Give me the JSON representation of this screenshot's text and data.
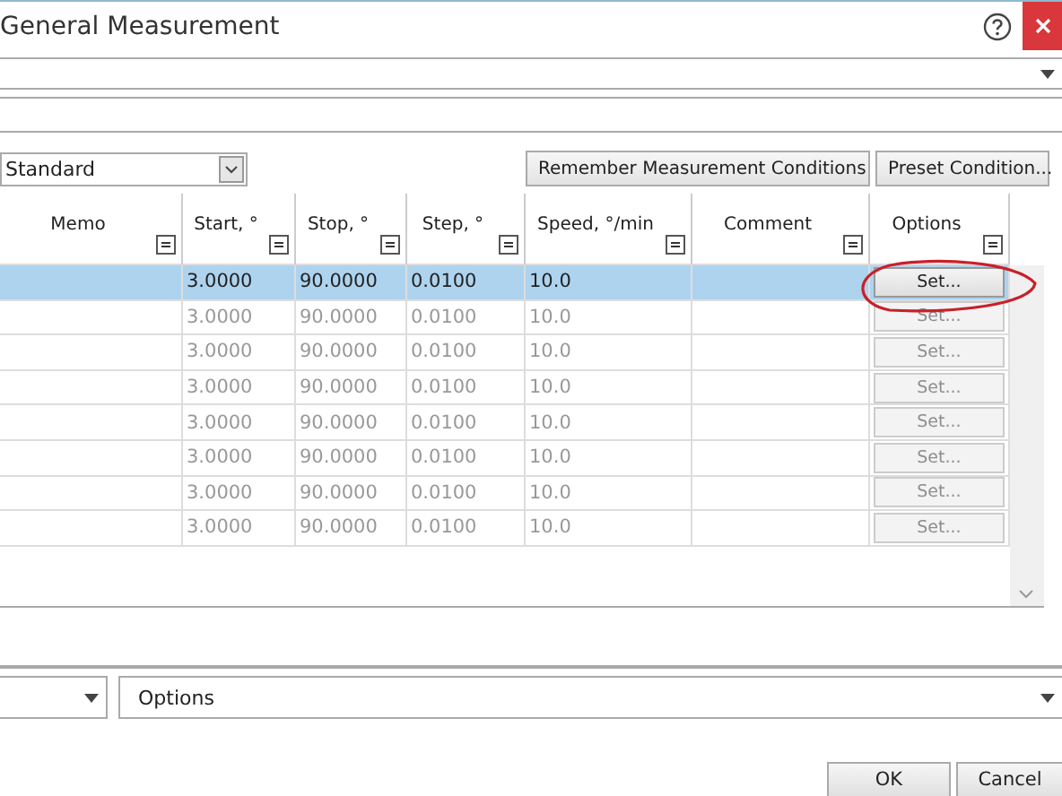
{
  "window": {
    "title": "General Measurement"
  },
  "condition_select": {
    "value": "Standard"
  },
  "toolbar_buttons": [
    "Remember Measurement Conditions",
    "Preset Condition..."
  ],
  "table": {
    "columns": [
      "Memo",
      "Start, °",
      "Stop, °",
      "Step, °",
      "Speed, °/min",
      "Comment",
      "Options"
    ],
    "rows": [
      {
        "selected": true,
        "disabled": false,
        "start": "3.0000",
        "stop": "90.0000",
        "step": "0.0100",
        "speed": "10.0",
        "option": "Set..."
      },
      {
        "selected": false,
        "disabled": true,
        "start": "3.0000",
        "stop": "90.0000",
        "step": "0.0100",
        "speed": "10.0",
        "option": "Set..."
      },
      {
        "selected": false,
        "disabled": true,
        "start": "3.0000",
        "stop": "90.0000",
        "step": "0.0100",
        "speed": "10.0",
        "option": "Set..."
      },
      {
        "selected": false,
        "disabled": true,
        "start": "3.0000",
        "stop": "90.0000",
        "step": "0.0100",
        "speed": "10.0",
        "option": "Set..."
      },
      {
        "selected": false,
        "disabled": true,
        "start": "3.0000",
        "stop": "90.0000",
        "step": "0.0100",
        "speed": "10.0",
        "option": "Set..."
      },
      {
        "selected": false,
        "disabled": true,
        "start": "3.0000",
        "stop": "90.0000",
        "step": "0.0100",
        "speed": "10.0",
        "option": "Set..."
      },
      {
        "selected": false,
        "disabled": true,
        "start": "3.0000",
        "stop": "90.0000",
        "step": "0.0100",
        "speed": "10.0",
        "option": "Set..."
      },
      {
        "selected": false,
        "disabled": true,
        "start": "3.0000",
        "stop": "90.0000",
        "step": "0.0100",
        "speed": "10.0",
        "option": "Set..."
      }
    ]
  },
  "options_select": {
    "value": "Options"
  },
  "buttons": [
    "OK",
    "Cancel"
  ]
}
